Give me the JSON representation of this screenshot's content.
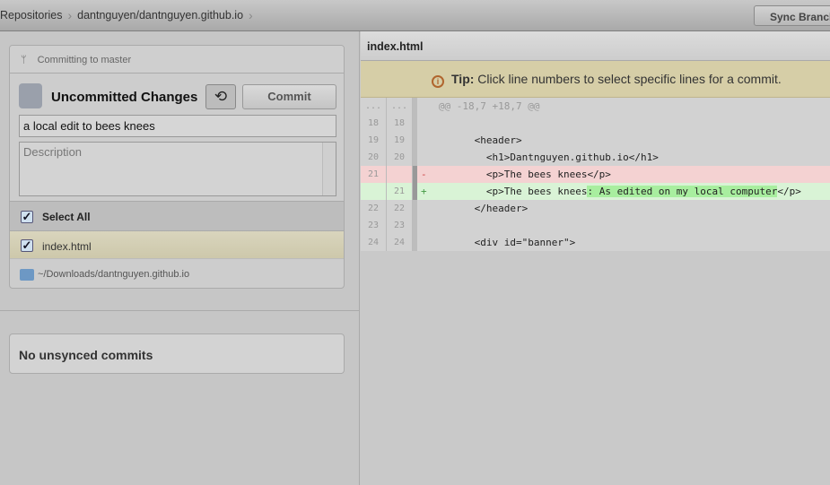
{
  "toolbar": {
    "crumbs": [
      "Repositories",
      "dantnguyen/dantnguyen.github.io"
    ],
    "sync_label": "Sync Branch"
  },
  "commit_panel": {
    "branch_text": "Committing to master",
    "title": "Uncommitted Changes",
    "commit_label": "Commit",
    "summary_value": "a local edit to bees knees",
    "description_placeholder": "Description",
    "select_all": "Select All",
    "files": [
      {
        "name": "index.html",
        "checked": true
      }
    ],
    "path": "~/Downloads/dantnguyen.github.io"
  },
  "unsynced": {
    "text": "No unsynced commits"
  },
  "diff": {
    "filename": "index.html",
    "tip_label": "Tip:",
    "tip_text": " Click line numbers to select specific lines for a commit.",
    "hunk": "@@ -18,7 +18,7 @@",
    "lines": [
      {
        "old": "...",
        "new": "...",
        "type": "hunk",
        "sign": "",
        "text": "@@ -18,7 +18,7 @@"
      },
      {
        "old": "18",
        "new": "18",
        "type": "ctx",
        "sign": "",
        "text": ""
      },
      {
        "old": "19",
        "new": "19",
        "type": "ctx",
        "sign": "",
        "text": "      <header>"
      },
      {
        "old": "20",
        "new": "20",
        "type": "ctx",
        "sign": "",
        "text": "        <h1>Dantnguyen.github.io</h1>"
      },
      {
        "old": "21",
        "new": "",
        "type": "del",
        "sign": "-",
        "text": "        <p>The bees knees</p>"
      },
      {
        "old": "",
        "new": "21",
        "type": "add",
        "sign": "+",
        "text": "        <p>The bees knees",
        "highlight": ": As edited on my local computer",
        "tail": "</p>"
      },
      {
        "old": "22",
        "new": "22",
        "type": "ctx",
        "sign": "",
        "text": "      </header>"
      },
      {
        "old": "23",
        "new": "23",
        "type": "ctx",
        "sign": "",
        "text": ""
      },
      {
        "old": "24",
        "new": "24",
        "type": "ctx",
        "sign": "",
        "text": "      <div id=\"banner\">"
      }
    ]
  }
}
